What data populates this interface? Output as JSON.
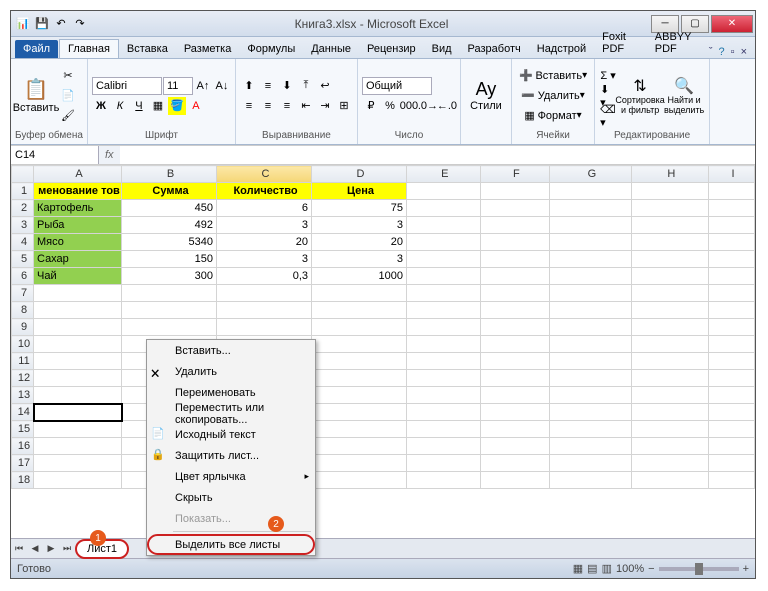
{
  "title": "Книга3.xlsx - Microsoft Excel",
  "tabs": {
    "file": "Файл",
    "home": "Главная",
    "insert": "Вставка",
    "layout": "Разметка",
    "formulas": "Формулы",
    "data": "Данные",
    "review": "Рецензир",
    "view": "Вид",
    "dev": "Разработч",
    "addins": "Надстрой",
    "foxit": "Foxit PDF",
    "abbyy": "ABBYY PDF"
  },
  "ribbon": {
    "clipboard": {
      "paste": "Вставить",
      "label": "Буфер обмена"
    },
    "font": {
      "name": "Calibri",
      "size": "11",
      "label": "Шрифт"
    },
    "align": {
      "label": "Выравнивание"
    },
    "number": {
      "format": "Общий",
      "label": "Число"
    },
    "styles": {
      "btn": "Стили",
      "label": ""
    },
    "cells": {
      "insert": "Вставить",
      "delete": "Удалить",
      "format": "Формат",
      "label": "Ячейки"
    },
    "edit": {
      "sort": "Сортировка и фильтр",
      "find": "Найти и выделить",
      "label": "Редактирование"
    }
  },
  "namebox": "C14",
  "headers": [
    "",
    "A",
    "B",
    "C",
    "D",
    "E",
    "F",
    "G",
    "H",
    "I"
  ],
  "rows": [
    {
      "n": 1,
      "a": "менование тов",
      "b": "Сумма",
      "c": "Количество",
      "d": "Цена",
      "hdr": true
    },
    {
      "n": 2,
      "a": "Картофель",
      "b": "450",
      "c": "6",
      "d": "75"
    },
    {
      "n": 3,
      "a": "Рыба",
      "b": "492",
      "c": "3",
      "d": "3"
    },
    {
      "n": 4,
      "a": "Мясо",
      "b": "5340",
      "c": "20",
      "d": "20"
    },
    {
      "n": 5,
      "a": "Сахар",
      "b": "150",
      "c": "3",
      "d": "3"
    },
    {
      "n": 6,
      "a": "Чай",
      "b": "300",
      "c": "0,3",
      "d": "1000"
    }
  ],
  "ctx": {
    "insert": "Вставить...",
    "delete": "Удалить",
    "rename": "Переименовать",
    "move": "Переместить или скопировать...",
    "source": "Исходный текст",
    "protect": "Защитить лист...",
    "color": "Цвет ярлычка",
    "hide": "Скрыть",
    "show": "Показать...",
    "selall": "Выделить все листы"
  },
  "sheet": "Лист1",
  "status": "Готово",
  "zoom": "100%"
}
